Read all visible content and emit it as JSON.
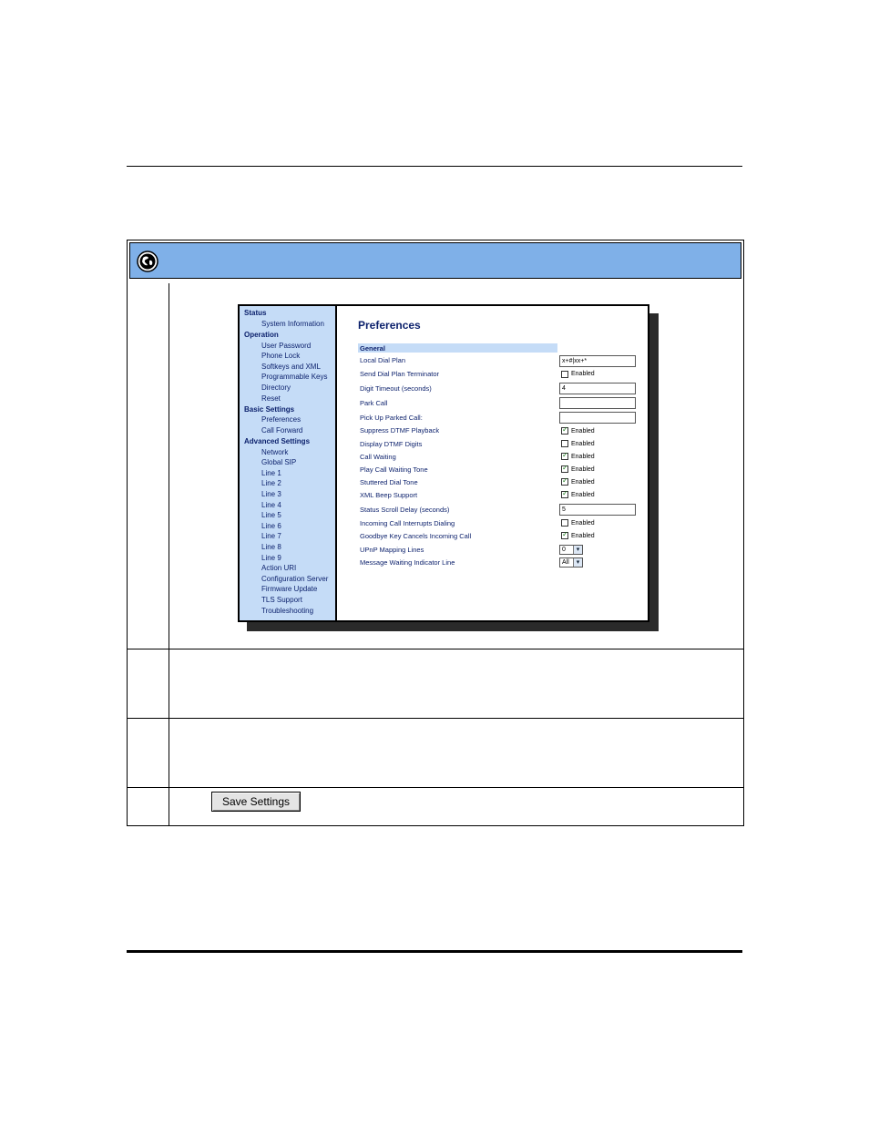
{
  "nav": {
    "status": "Status",
    "system_information": "System Information",
    "operation": "Operation",
    "user_password": "User Password",
    "phone_lock": "Phone Lock",
    "softkeys_xml": "Softkeys and XML",
    "programmable_keys": "Programmable Keys",
    "directory": "Directory",
    "reset": "Reset",
    "basic_settings": "Basic Settings",
    "preferences": "Preferences",
    "call_forward": "Call Forward",
    "advanced_settings": "Advanced Settings",
    "network": "Network",
    "global_sip": "Global SIP",
    "line1": "Line 1",
    "line2": "Line 2",
    "line3": "Line 3",
    "line4": "Line 4",
    "line5": "Line 5",
    "line6": "Line 6",
    "line7": "Line 7",
    "line8": "Line 8",
    "line9": "Line 9",
    "action_uri": "Action URI",
    "configuration_server": "Configuration Server",
    "firmware_update": "Firmware Update",
    "tls_support": "TLS Support",
    "troubleshooting": "Troubleshooting"
  },
  "page": {
    "title": "Preferences",
    "general": "General",
    "enabled": "Enabled"
  },
  "rows": {
    "local_dial_plan": {
      "label": "Local Dial Plan",
      "value": "x+#|xx+*"
    },
    "send_dial_plan_terminator": {
      "label": "Send Dial Plan Terminator",
      "checked": false
    },
    "digit_timeout": {
      "label": "Digit Timeout (seconds)",
      "value": "4"
    },
    "park_call": {
      "label": "Park Call",
      "value": ""
    },
    "pick_up_parked_call": {
      "label": "Pick Up Parked Call:",
      "value": ""
    },
    "suppress_dtmf": {
      "label": "Suppress DTMF Playback",
      "checked": true
    },
    "display_dtmf": {
      "label": "Display DTMF Digits",
      "checked": false
    },
    "call_waiting": {
      "label": "Call Waiting",
      "checked": true
    },
    "play_call_waiting_tone": {
      "label": "Play Call Waiting Tone",
      "checked": true
    },
    "stuttered_dial_tone": {
      "label": "Stuttered Dial Tone",
      "checked": true
    },
    "xml_beep_support": {
      "label": "XML Beep Support",
      "checked": true
    },
    "status_scroll_delay": {
      "label": "Status Scroll Delay (seconds)",
      "value": "5"
    },
    "incoming_call_interrupts": {
      "label": "Incoming Call Interrupts Dialing",
      "checked": false
    },
    "goodbye_key_cancels": {
      "label": "Goodbye Key Cancels Incoming Call",
      "checked": true
    },
    "upnp_mapping_lines": {
      "label": "UPnP Mapping Lines",
      "value": "0"
    },
    "mwi_line": {
      "label": "Message Waiting Indicator Line",
      "value": "All"
    }
  },
  "save_button": "Save Settings",
  "icons": {
    "banner": "globe-icon"
  }
}
